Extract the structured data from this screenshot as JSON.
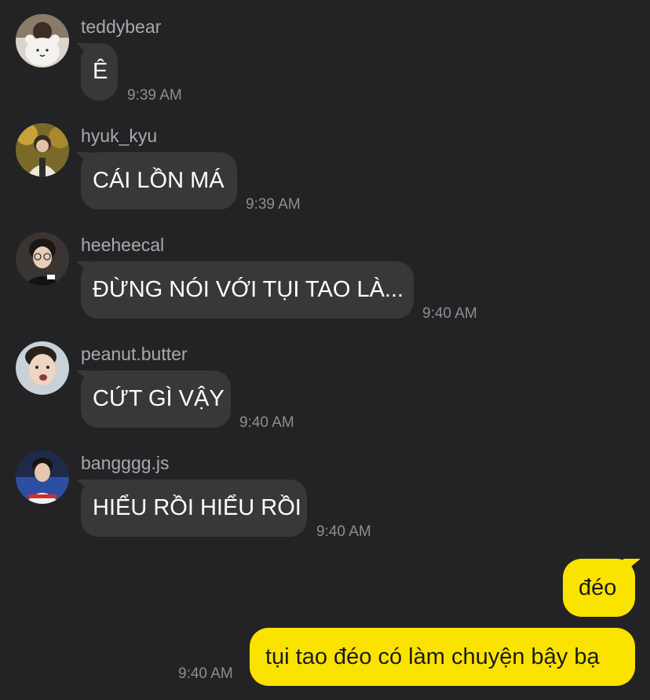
{
  "messages_in": [
    {
      "sender": "teddybear",
      "text": "Ê",
      "time": "9:39 AM",
      "avatar": "white-bear-plush-avatar"
    },
    {
      "sender": "hyuk_kyu",
      "text": "CÁI LỒN MÁ",
      "time": "9:39 AM",
      "avatar": "person-autumn-photo-avatar"
    },
    {
      "sender": "heeheecal",
      "text": "ĐỪNG NÓI VỚI TỤI TAO LÀ...",
      "time": "9:40 AM",
      "avatar": "person-glasses-avatar"
    },
    {
      "sender": "peanut.butter",
      "text": "CỨT GÌ VẬY",
      "time": "9:40 AM",
      "avatar": "person-surprised-avatar"
    },
    {
      "sender": "bangggg.js",
      "text": "HIỂU RỒI HIỂU RỒI",
      "time": "9:40 AM",
      "avatar": "person-jersey-avatar"
    }
  ],
  "messages_out": [
    {
      "text": "đéo"
    },
    {
      "text": "tụi tao đéo có làm chuyện bậy bạ",
      "time": "9:40 AM"
    }
  ],
  "colors": {
    "background": "#232325",
    "incoming_bubble": "#38383b",
    "outgoing_bubble": "#fbe300",
    "sender_text": "#a9a9ad",
    "time_text": "#8e8e92"
  }
}
